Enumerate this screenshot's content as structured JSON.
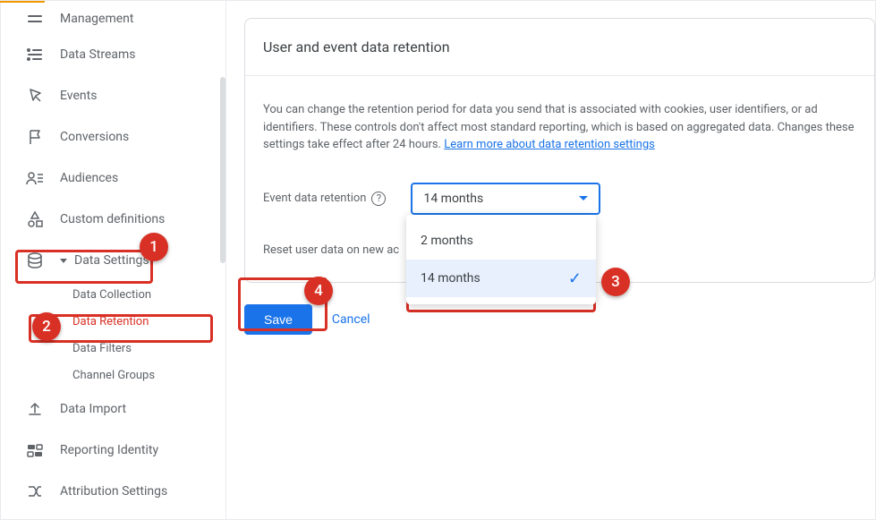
{
  "sidebar": {
    "items": [
      {
        "label": "Management",
        "icon": "lines"
      },
      {
        "label": "Data Streams",
        "icon": "streams"
      },
      {
        "label": "Events",
        "icon": "cursor"
      },
      {
        "label": "Conversions",
        "icon": "flag"
      },
      {
        "label": "Audiences",
        "icon": "people"
      },
      {
        "label": "Custom definitions",
        "icon": "shapes"
      },
      {
        "label": "Data Settings",
        "icon": "database",
        "expanded": true,
        "children": [
          {
            "label": "Data Collection"
          },
          {
            "label": "Data Retention",
            "active": true
          },
          {
            "label": "Data Filters"
          },
          {
            "label": "Channel Groups"
          }
        ]
      },
      {
        "label": "Data Import",
        "icon": "upload"
      },
      {
        "label": "Reporting Identity",
        "icon": "identity"
      },
      {
        "label": "Attribution Settings",
        "icon": "attribution"
      }
    ]
  },
  "card": {
    "title": "User and event data retention",
    "description_pre": "You can change the retention period for data you send that is associated with cookies, user identifiers, or ad identifiers. These controls don't affect most standard reporting, which is based on aggregated data. Changes these settings take effect after 24 hours. ",
    "link_text": "Learn more about data retention settings",
    "event_label": "Event data retention",
    "select_value": "14 months",
    "reset_label": "Reset user data on new ac",
    "options": [
      {
        "label": "2 months",
        "selected": false
      },
      {
        "label": "14 months",
        "selected": true
      }
    ],
    "save": "Save",
    "cancel": "Cancel"
  },
  "annotations": {
    "b1": "1",
    "b2": "2",
    "b3": "3",
    "b4": "4"
  }
}
